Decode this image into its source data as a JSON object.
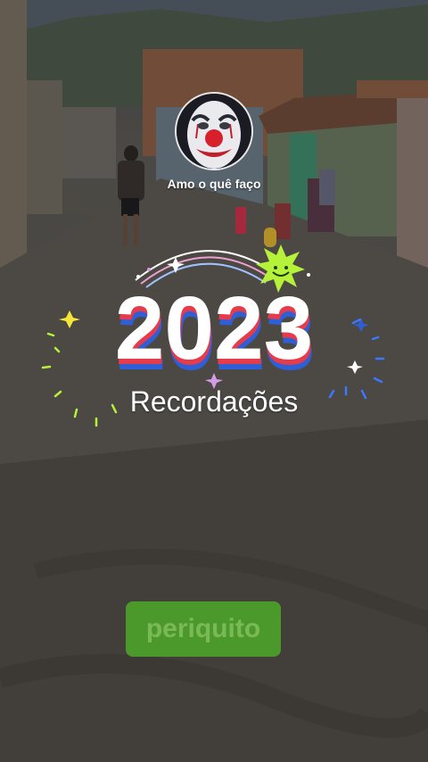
{
  "profile": {
    "name": "Amo o quê faço"
  },
  "recap": {
    "year": "2023",
    "subtitle": "Recordações"
  },
  "action": {
    "button_label": "periquito"
  },
  "colors": {
    "digit_white": "#ffffff",
    "digit_red": "#e63b4a",
    "digit_blue": "#2f5fd6",
    "sparkle_yellow": "#f4e63a",
    "burst_green": "#b6f23a",
    "button_green": "#4ea32a"
  }
}
